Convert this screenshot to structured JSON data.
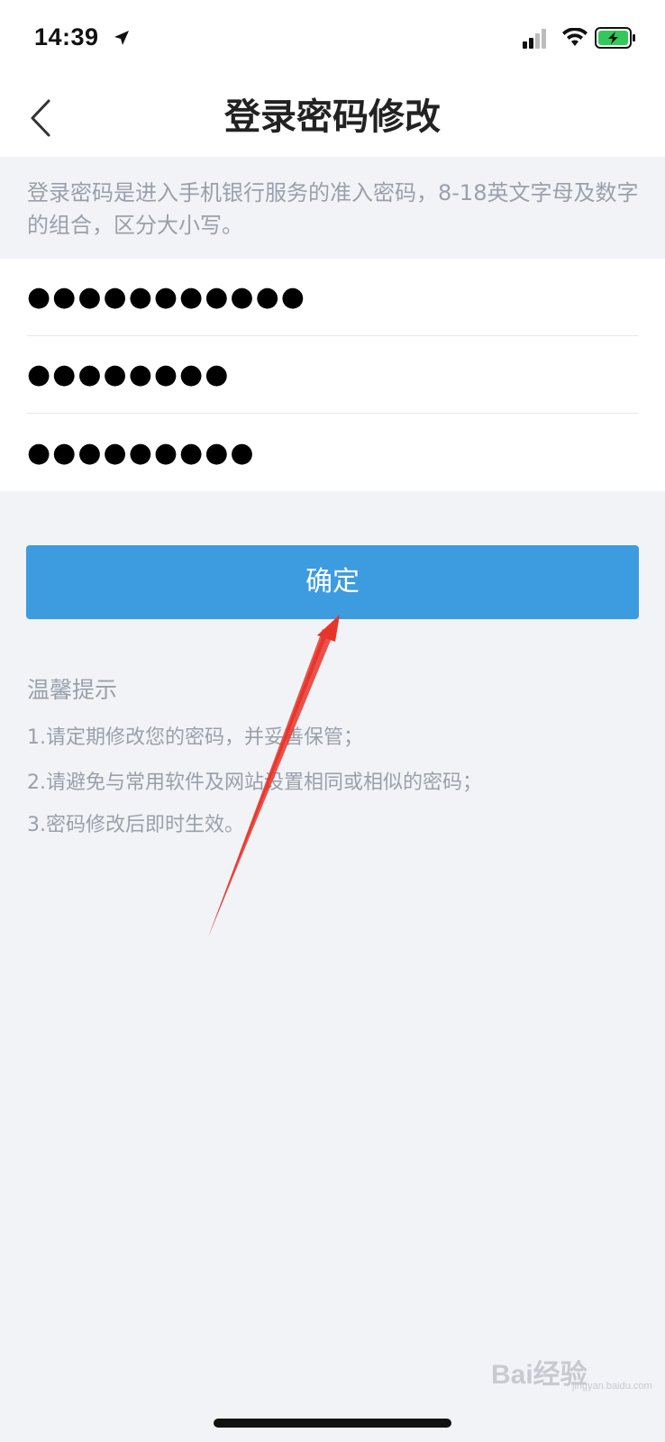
{
  "status_bar": {
    "time": "14:39"
  },
  "nav": {
    "title": "登录密码修改"
  },
  "description": "登录密码是进入手机银行服务的准入密码，8-18英文字母及数字的组合，区分大小写。",
  "form": {
    "fields": [
      {
        "value": "●●●●●●●●●●●"
      },
      {
        "value": "●●●●●●●●"
      },
      {
        "value": "●●●●●●●●●"
      }
    ]
  },
  "confirm_label": "确定",
  "tips": {
    "title": "温馨提示",
    "items": [
      "1.请定期修改您的密码，并妥善保管；",
      "2.请避免与常用软件及网站设置相同或相似的密码；",
      "3.密码修改后即时生效。"
    ]
  },
  "colors": {
    "accent": "#3d9be0",
    "arrow": "#e8352b",
    "background": "#f2f3f7"
  },
  "watermark": {
    "text": "Bai经验",
    "sub": "jingyan.baidu.com"
  }
}
